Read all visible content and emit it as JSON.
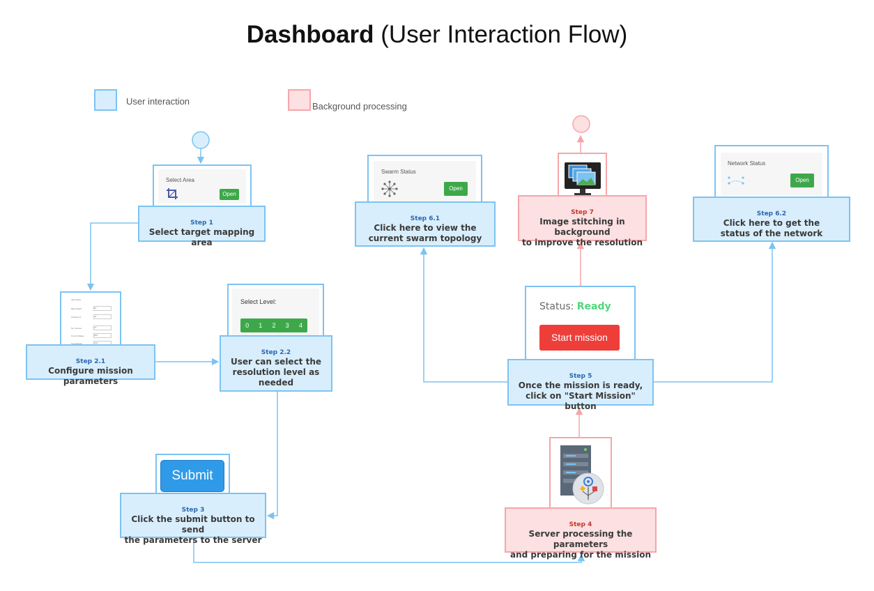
{
  "title": {
    "bold": "Dashboard",
    "rest": " (User Interaction Flow)"
  },
  "legend": {
    "user": {
      "label": "User interaction",
      "color": "#d9eefc"
    },
    "background": {
      "label": "Background processing",
      "color": "#fde0e1"
    }
  },
  "steps": {
    "s1": {
      "num": "Step 1",
      "desc": [
        "Select target mapping area"
      ]
    },
    "s21": {
      "num": "Step 2.1",
      "desc": [
        "Configure mission parameters"
      ]
    },
    "s22": {
      "num": "Step 2.2",
      "desc": [
        "User can select the",
        "resolution level as",
        "needed"
      ]
    },
    "s3": {
      "num": "Step 3",
      "desc": [
        "Click the submit button to send",
        "the parameters to the server"
      ]
    },
    "s4": {
      "num": "Step 4",
      "desc": [
        "Server processing the parameters",
        "and preparing for the mission"
      ]
    },
    "s5": {
      "num": "Step 5",
      "desc": [
        "Once the mission is ready,",
        "click on \"Start Mission\" button"
      ]
    },
    "s61": {
      "num": "Step 6.1",
      "desc": [
        "Click here to view the",
        "current swarm topology"
      ]
    },
    "s62": {
      "num": "Step 6.2",
      "desc": [
        "Click here to get the",
        "status of the network"
      ]
    },
    "s7": {
      "num": "Step 7",
      "desc": [
        "Image stitching in background",
        "to improve the resolution"
      ]
    }
  },
  "cards": {
    "select_area": {
      "title": "Select Area",
      "button": "Open",
      "icon": "crop-icon"
    },
    "mission_form": {
      "title": "Input Data",
      "rows": [
        {
          "label": "Max Height",
          "value": "50"
        },
        {
          "label": "Overlap %",
          "value": "40"
        },
        {
          "label": "No. Drones",
          "value": "10"
        },
        {
          "label": "Comm Range",
          "value": "500"
        },
        {
          "label": "Cam Range",
          "value": "100"
        }
      ]
    },
    "select_level": {
      "title": "Select Level:",
      "levels": [
        "0",
        "1",
        "2",
        "3",
        "4"
      ]
    },
    "submit": {
      "label": "Submit"
    },
    "start": {
      "status_label": "Status:",
      "status_value": "Ready",
      "button": "Start mission"
    },
    "swarm": {
      "title": "Swarm Status",
      "button": "Open",
      "icon": "swarm-topology-icon"
    },
    "network": {
      "title": "Network Status",
      "button": "Open",
      "icon": "network-icon"
    },
    "stitching": {
      "icon": "monitor-images-icon"
    },
    "server": {
      "icon": "server-settings-icon"
    }
  },
  "colors": {
    "blue_border": "#7cc3f2",
    "red_border": "#f4a6aa",
    "green": "#3da84a",
    "submit_blue": "#2f9ae8",
    "start_red": "#ee3e3a",
    "ready_green": "#4fd77c"
  }
}
